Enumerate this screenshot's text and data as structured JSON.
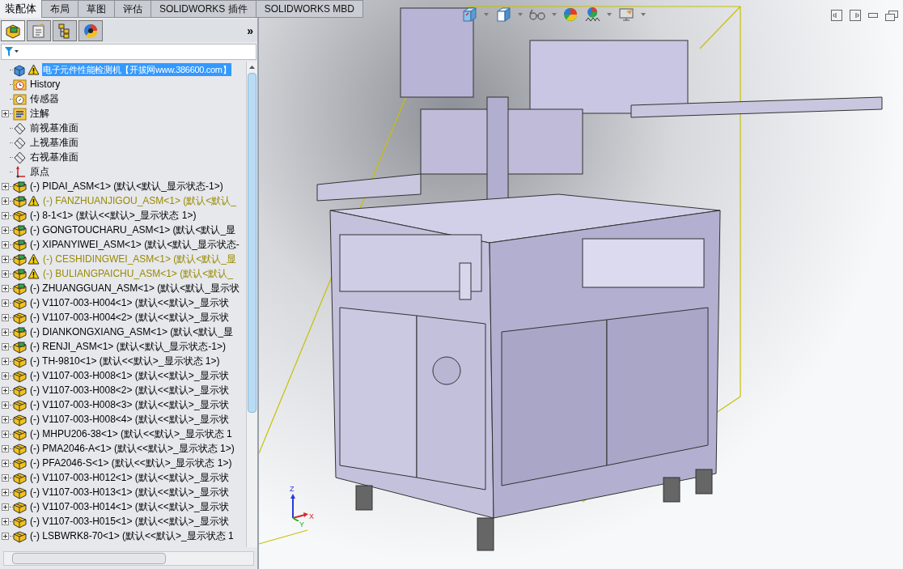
{
  "command_tabs": [
    {
      "label": "装配体",
      "selected": true
    },
    {
      "label": "布局",
      "selected": false
    },
    {
      "label": "草图",
      "selected": false
    },
    {
      "label": "评估",
      "selected": false
    },
    {
      "label": "SOLIDWORKS 插件",
      "selected": false
    },
    {
      "label": "SOLIDWORKS MBD",
      "selected": false
    }
  ],
  "panel_tabs": [
    {
      "kind": "tree",
      "selected": true
    },
    {
      "kind": "property",
      "selected": false
    },
    {
      "kind": "config",
      "selected": false
    },
    {
      "kind": "display",
      "selected": false
    }
  ],
  "panel_more": "»",
  "tree": [
    {
      "kind": "root",
      "label": "电子元件性能检测机【开拔网www.386600.com】",
      "warning": true,
      "selected": true,
      "expandable": false
    },
    {
      "kind": "history",
      "label": "History",
      "warning": false,
      "selected": false,
      "expandable": false
    },
    {
      "kind": "sensor",
      "label": "传感器",
      "warning": false,
      "selected": false,
      "expandable": false
    },
    {
      "kind": "annotation",
      "label": "注解",
      "warning": false,
      "selected": false,
      "expandable": true
    },
    {
      "kind": "plane",
      "label": "前视基准面",
      "warning": false,
      "selected": false,
      "expandable": false
    },
    {
      "kind": "plane",
      "label": "上视基准面",
      "warning": false,
      "selected": false,
      "expandable": false
    },
    {
      "kind": "plane",
      "label": "右视基准面",
      "warning": false,
      "selected": false,
      "expandable": false
    },
    {
      "kind": "origin",
      "label": "原点",
      "warning": false,
      "selected": false,
      "expandable": false
    },
    {
      "kind": "assembly",
      "label": "(-) PIDAI_ASM<1> (默认<默认_显示状态-1>)",
      "warning": false,
      "selected": false,
      "expandable": true
    },
    {
      "kind": "assembly",
      "label": "(-) FANZHUANJIGOU_ASM<1> (默认<默认_",
      "warning": true,
      "selected": false,
      "expandable": true
    },
    {
      "kind": "part",
      "label": "(-) 8-1<1> (默认<<默认>_显示状态 1>)",
      "warning": false,
      "selected": false,
      "expandable": true
    },
    {
      "kind": "assembly",
      "label": "(-) GONGTOUCHARU_ASM<1> (默认<默认_显",
      "warning": false,
      "selected": false,
      "expandable": true
    },
    {
      "kind": "assembly",
      "label": "(-) XIPANYIWEI_ASM<1> (默认<默认_显示状态-",
      "warning": false,
      "selected": false,
      "expandable": true
    },
    {
      "kind": "assembly",
      "label": "(-) CESHIDINGWEI_ASM<1> (默认<默认_显",
      "warning": true,
      "selected": false,
      "expandable": true
    },
    {
      "kind": "assembly",
      "label": "(-) BULIANGPAICHU_ASM<1> (默认<默认_",
      "warning": true,
      "selected": false,
      "expandable": true
    },
    {
      "kind": "assembly",
      "label": "(-) ZHUANGGUAN_ASM<1> (默认<默认_显示状",
      "warning": false,
      "selected": false,
      "expandable": true
    },
    {
      "kind": "part",
      "label": "(-) V1107-003-H004<1> (默认<<默认>_显示状",
      "warning": false,
      "selected": false,
      "expandable": true
    },
    {
      "kind": "part",
      "label": "(-) V1107-003-H004<2> (默认<<默认>_显示状",
      "warning": false,
      "selected": false,
      "expandable": true
    },
    {
      "kind": "assembly",
      "label": "(-) DIANKONGXIANG_ASM<1> (默认<默认_显",
      "warning": false,
      "selected": false,
      "expandable": true
    },
    {
      "kind": "assembly",
      "label": "(-) RENJI_ASM<1> (默认<默认_显示状态-1>)",
      "warning": false,
      "selected": false,
      "expandable": true
    },
    {
      "kind": "part",
      "label": "(-) TH-9810<1> (默认<<默认>_显示状态 1>)",
      "warning": false,
      "selected": false,
      "expandable": true
    },
    {
      "kind": "part",
      "label": "(-) V1107-003-H008<1> (默认<<默认>_显示状",
      "warning": false,
      "selected": false,
      "expandable": true
    },
    {
      "kind": "part",
      "label": "(-) V1107-003-H008<2> (默认<<默认>_显示状",
      "warning": false,
      "selected": false,
      "expandable": true
    },
    {
      "kind": "part",
      "label": "(-) V1107-003-H008<3> (默认<<默认>_显示状",
      "warning": false,
      "selected": false,
      "expandable": true
    },
    {
      "kind": "part",
      "label": "(-) V1107-003-H008<4> (默认<<默认>_显示状",
      "warning": false,
      "selected": false,
      "expandable": true
    },
    {
      "kind": "part",
      "label": "(-) MHPU206-38<1> (默认<<默认>_显示状态 1",
      "warning": false,
      "selected": false,
      "expandable": true
    },
    {
      "kind": "part",
      "label": "(-) PMA2046-A<1> (默认<<默认>_显示状态 1>)",
      "warning": false,
      "selected": false,
      "expandable": true
    },
    {
      "kind": "part",
      "label": "(-) PFA2046-S<1> (默认<<默认>_显示状态 1>)",
      "warning": false,
      "selected": false,
      "expandable": true
    },
    {
      "kind": "part",
      "label": "(-) V1107-003-H012<1> (默认<<默认>_显示状",
      "warning": false,
      "selected": false,
      "expandable": true
    },
    {
      "kind": "part",
      "label": "(-) V1107-003-H013<1> (默认<<默认>_显示状",
      "warning": false,
      "selected": false,
      "expandable": true
    },
    {
      "kind": "part",
      "label": "(-) V1107-003-H014<1> (默认<<默认>_显示状",
      "warning": false,
      "selected": false,
      "expandable": true
    },
    {
      "kind": "part",
      "label": "(-) V1107-003-H015<1> (默认<<默认>_显示状",
      "warning": false,
      "selected": false,
      "expandable": true
    },
    {
      "kind": "part",
      "label": "(-) LSBWRK8-70<1> (默认<<默认>_显示状态 1",
      "warning": false,
      "selected": false,
      "expandable": true
    }
  ],
  "triad": {
    "z": "Z",
    "x": "X",
    "y": "Y"
  }
}
